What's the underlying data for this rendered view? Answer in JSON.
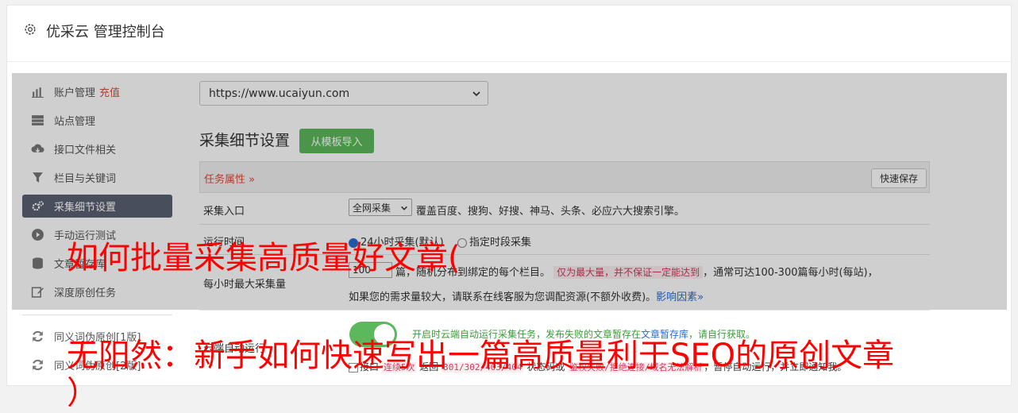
{
  "header": {
    "title": "优采云 管理控制台",
    "icon": "gear-icon"
  },
  "sidebar": {
    "items": [
      {
        "label": "账户管理",
        "badge": "充值",
        "icon": "bar-chart-icon"
      },
      {
        "label": "站点管理",
        "icon": "server-icon"
      },
      {
        "label": "接口文件相关",
        "icon": "cloud-download-icon"
      },
      {
        "label": "栏目与关键词",
        "icon": "filter-icon"
      },
      {
        "label": "采集细节设置",
        "icon": "gears-icon",
        "active": true
      },
      {
        "label": "手动运行测试",
        "icon": "play-icon"
      },
      {
        "label": "文章暂存库",
        "icon": "database-icon"
      },
      {
        "label": "深度原创任务",
        "icon": "edit-icon"
      },
      {
        "label": "同义词伪原创[1版]",
        "icon": "refresh-icon"
      },
      {
        "label": "同义词伪原创[2版]",
        "icon": "refresh-icon"
      }
    ]
  },
  "main": {
    "site_select": "https://www.ucaiyun.com",
    "section_title": "采集细节设置",
    "import_button": "从模板导入",
    "task_attr": "任务属性 »",
    "quick_save": "快速保存",
    "rows": {
      "entry": {
        "label": "采集入口",
        "select": "全网采集",
        "desc": "覆盖百度、搜狗、好搜、神马、头条、必应六大搜索引擎。"
      },
      "runtime": {
        "label": "运行时间",
        "opt1": "24小时采集(默认)",
        "opt2": "指定时段采集"
      },
      "max_per_hour": {
        "label": "每小时最大采集量",
        "value": "100",
        "text1": "篇，随机分布到绑定的每个栏目。",
        "note": "仅为最大量，并不保证一定能达到",
        "text2": "，通常可达100-300篇每小时(每站)，",
        "line2": "如果您的需求量较大，请联系在线客服为您调配资源(不额外收费)。",
        "link": "影响因素»"
      },
      "auto_run": {
        "label": "云端自动运行",
        "green_text": "开启时云端自动运行采集任务，发布失败的文章暂存在",
        "link": "文章暂存库",
        "green_tail": "，请自行获取。",
        "cb_prefix": "接口",
        "red1": "连续5次",
        "mid1": "返回",
        "red2": "301/302/403/404",
        "mid2": "状态码或",
        "red3": "鉴权失败/拒绝连接/域名无法解析",
        "tail": "，暂停自动运行，并立即通知我。"
      }
    }
  },
  "overlay": {
    "line1": "如何批量采集高质量好文章(",
    "line2": "无阳然：新手如何快速写出一篇高质量利于SEO的原创文章",
    "line3": "）"
  }
}
